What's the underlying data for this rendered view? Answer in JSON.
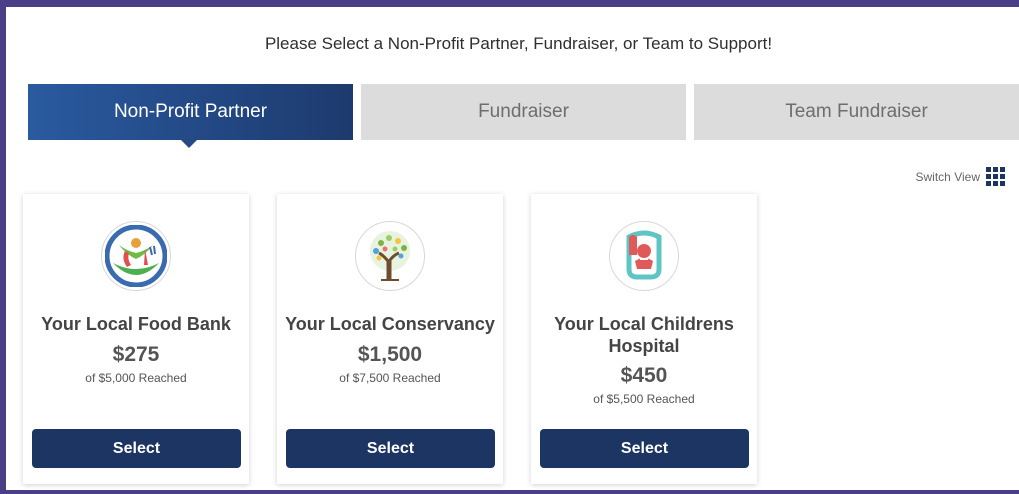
{
  "heading": "Please Select a Non-Profit Partner, Fundraiser, or Team to Support!",
  "tabs": [
    {
      "label": "Non-Profit Partner",
      "active": true
    },
    {
      "label": "Fundraiser",
      "active": false
    },
    {
      "label": "Team Fundraiser",
      "active": false
    }
  ],
  "switch_view": {
    "label": "Switch View",
    "icon": "grid-icon"
  },
  "cards": [
    {
      "name": "Your Local Food Bank",
      "amount": "$275",
      "goal": "of $5,000 Reached",
      "button": "Select",
      "icon": "food-bank-logo-icon"
    },
    {
      "name": "Your Local Conservancy",
      "amount": "$1,500",
      "goal": "of $7,500 Reached",
      "button": "Select",
      "icon": "tree-logo-icon"
    },
    {
      "name": "Your Local Childrens Hospital",
      "amount": "$450",
      "goal": "of $5,500 Reached",
      "button": "Select",
      "icon": "hospital-logo-icon"
    }
  ],
  "colors": {
    "frame": "#4a3f86",
    "accent": "#1c3563",
    "tab_active_start": "#2a5aa0",
    "tab_active_end": "#1d3a6e",
    "tab_inactive": "#dcdcdc"
  }
}
